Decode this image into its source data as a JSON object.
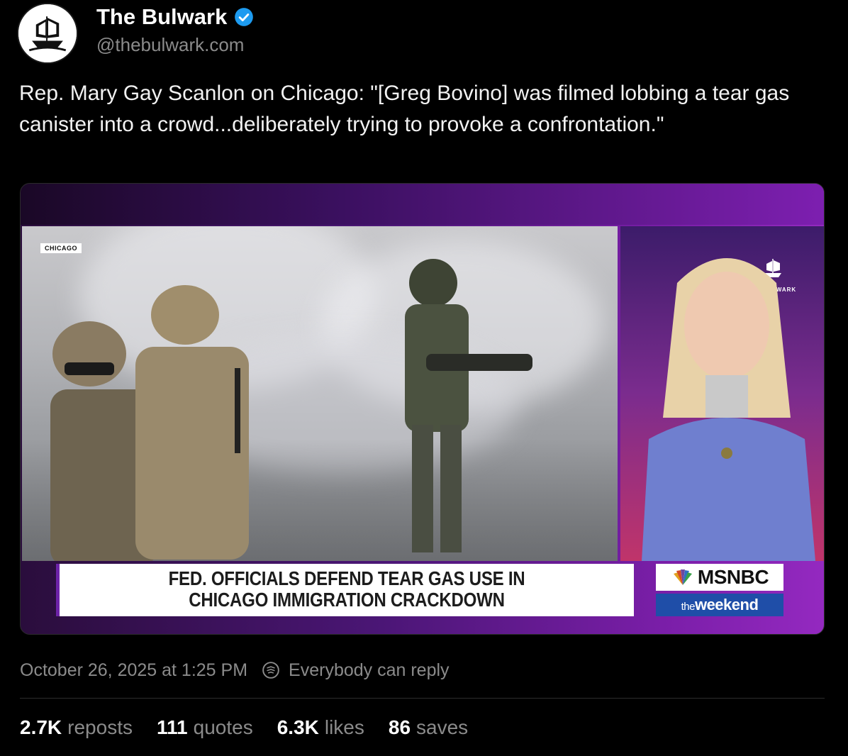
{
  "author": {
    "name": "The Bulwark",
    "handle": "@thebulwark.com",
    "verified": true
  },
  "post": {
    "text": "Rep. Mary Gay Scanlon on Chicago: \"[Greg Bovino] was filmed lobbing a tear gas canister into a crowd...deliberately trying to provoke a confrontation.\""
  },
  "video": {
    "location_tag": "CHICAGO",
    "watermark": "THEBULWARK",
    "headline_line1": "FED. OFFICIALS DEFEND TEAR GAS USE IN",
    "headline_line2": "CHICAGO IMMIGRATION CRACKDOWN",
    "network": "MSNBC",
    "show_prefix": "the",
    "show_name": "weekend"
  },
  "meta": {
    "timestamp": "October 26, 2025 at 1:25 PM",
    "reply_setting": "Everybody can reply"
  },
  "stats": [
    {
      "value": "2.7K",
      "label": "reposts"
    },
    {
      "value": "111",
      "label": "quotes"
    },
    {
      "value": "6.3K",
      "label": "likes"
    },
    {
      "value": "86",
      "label": "saves"
    }
  ],
  "colors": {
    "background": "#000000",
    "muted_text": "#8b8b8b",
    "verified": "#1d9bf0",
    "msnbc_blue": "#1f4ea8"
  },
  "icons": {
    "verified": "verified-badge-icon",
    "reply": "reply-settings-icon",
    "avatar": "ship-logo-icon"
  }
}
